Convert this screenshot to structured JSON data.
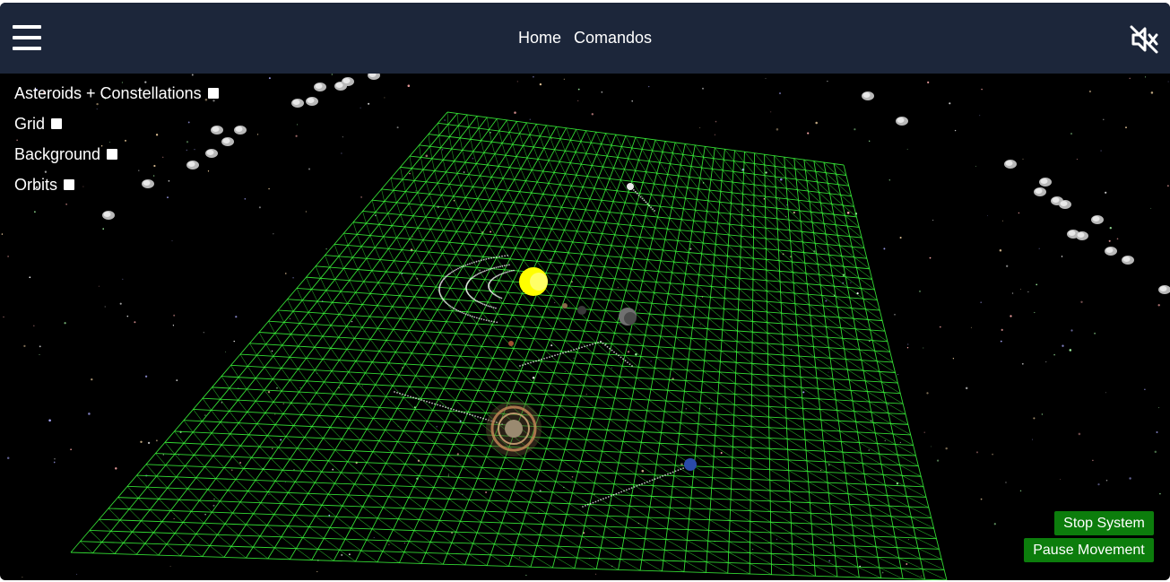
{
  "header": {
    "menu_icon": "hamburger-menu-icon",
    "nav": [
      {
        "label": "Home"
      },
      {
        "label": "Comandos"
      }
    ],
    "mute_icon": "speaker-muted-icon",
    "background_color": "#1c263a"
  },
  "toggles": [
    {
      "label": "Asteroids + Constellations",
      "checked": false
    },
    {
      "label": "Grid",
      "checked": false
    },
    {
      "label": "Background",
      "checked": false
    },
    {
      "label": "Orbits",
      "checked": false
    }
  ],
  "controls": {
    "stop_label": "Stop System",
    "pause_label": "Pause Movement",
    "button_color": "#0c7d0c"
  },
  "scene": {
    "grid_color": "#3cff3c",
    "sun_color": "#ffff00",
    "background_color": "#000000"
  }
}
